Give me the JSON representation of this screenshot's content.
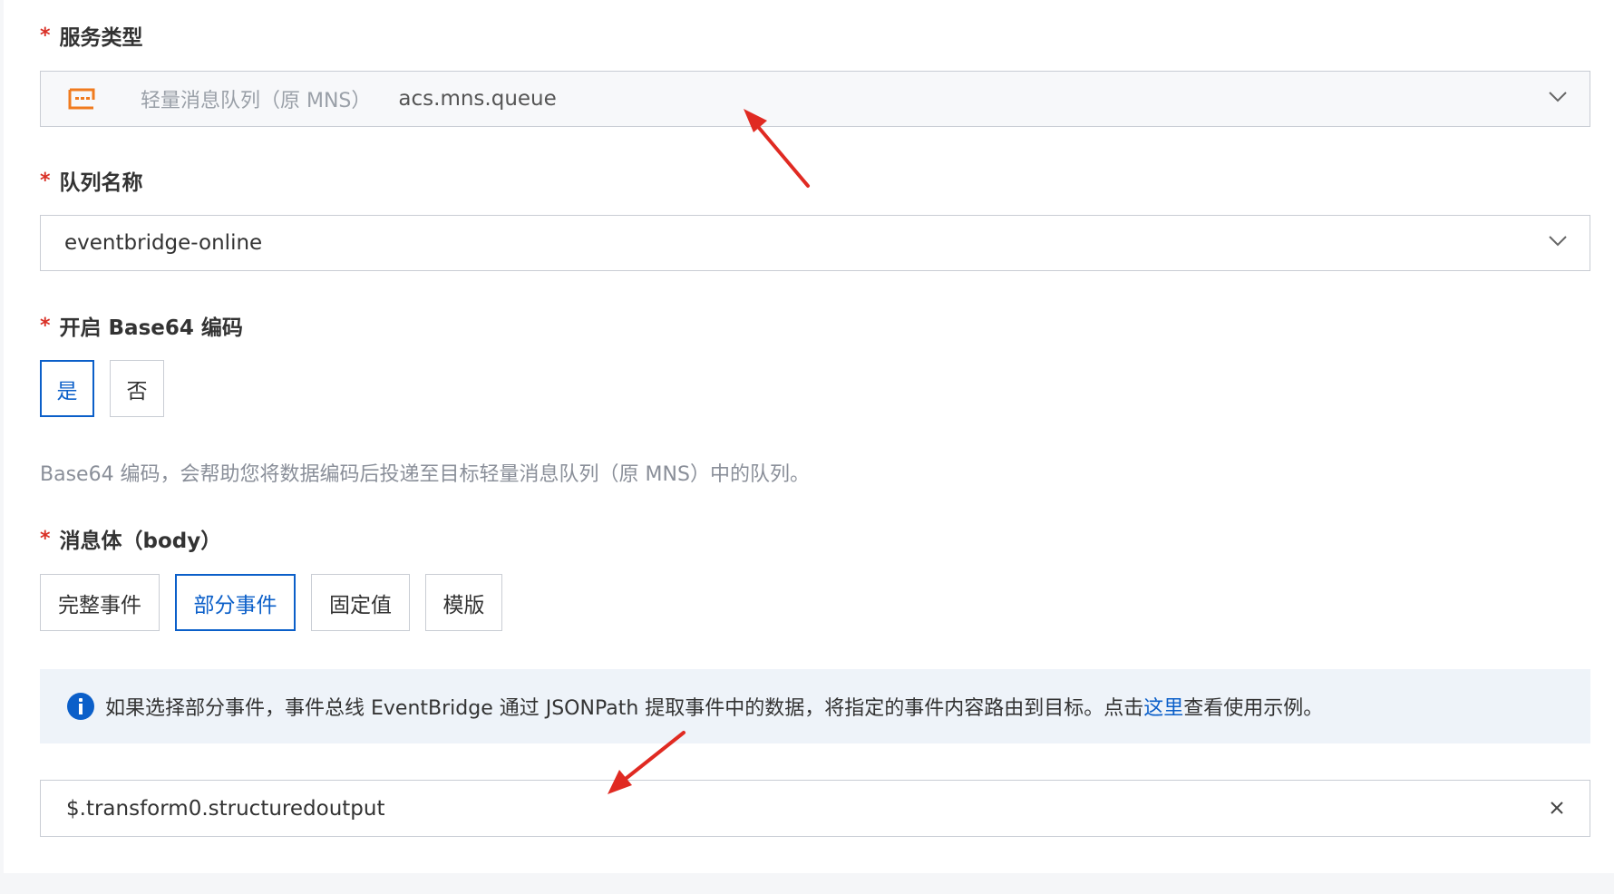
{
  "fields": {
    "service_type": {
      "label": "服务类型",
      "required_mark": "*",
      "icon": "mns-queue-icon",
      "product_name": "轻量消息队列（原 MNS）",
      "product_code": "acs.mns.queue"
    },
    "queue_name": {
      "label": "队列名称",
      "required_mark": "*",
      "value": "eventbridge-online"
    },
    "base64": {
      "label": "开启 Base64 编码",
      "required_mark": "*",
      "options": [
        "是",
        "否"
      ],
      "selected": "是",
      "hint": "Base64 编码，会帮助您将数据编码后投递至目标轻量消息队列（原 MNS）中的队列。"
    },
    "body": {
      "label": "消息体（body）",
      "required_mark": "*",
      "options": [
        "完整事件",
        "部分事件",
        "固定值",
        "模版"
      ],
      "selected": "部分事件",
      "notice_prefix": "如果选择部分事件，事件总线 EventBridge 通过 JSONPath 提取事件中的数据，将指定的事件内容路由到目标。点击",
      "notice_link": "这里",
      "notice_suffix": "查看使用示例。",
      "jsonpath_value": "$.transform0.structuredoutput"
    }
  },
  "colors": {
    "accent": "#0b5fc9",
    "required": "#d93026",
    "icon_orange": "#f07b1f",
    "annotation_arrow": "#e02a22"
  }
}
